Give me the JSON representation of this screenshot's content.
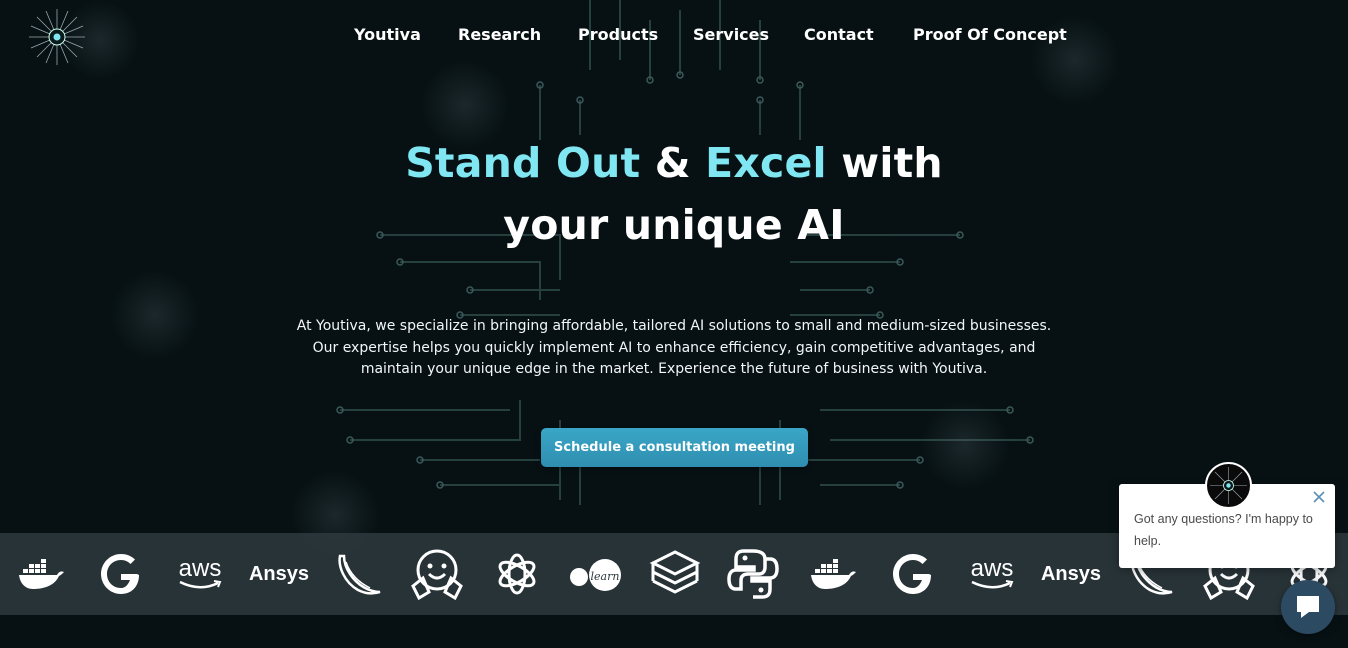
{
  "nav": {
    "items": [
      {
        "label": "Youtiva"
      },
      {
        "label": "Research"
      },
      {
        "label": "Products"
      },
      {
        "label": "Services"
      },
      {
        "label": "Contact"
      },
      {
        "label": "Proof Of Concept"
      }
    ]
  },
  "hero": {
    "title_part1": "Stand Out",
    "title_amp": " & ",
    "title_part2": "Excel",
    "title_part3": " with",
    "title_line2": "your unique AI",
    "description_line1": "At Youtiva, we specialize in bringing affordable, tailored AI solutions to small and medium-sized businesses.",
    "description_line2": "Our expertise helps you quickly implement AI to enhance efficiency, gain competitive advantages, and",
    "description_line3": "maintain your unique edge in the market. Experience the future of business with Youtiva.",
    "cta_label": "Schedule a consultation meeting"
  },
  "partners": {
    "aws_label": "aws",
    "ansys_label": "Ansys",
    "icons": [
      "docker-icon",
      "google-icon",
      "aws-logo",
      "ansys-logo",
      "flask-icon",
      "huggingface-icon",
      "openai-icon",
      "scikit-learn-icon",
      "layers-icon",
      "python-icon"
    ]
  },
  "chat": {
    "message": "Got any questions? I'm happy to help."
  },
  "colors": {
    "accent": "#7fe6f2",
    "cta": "#3aa6c7",
    "background": "#071114"
  }
}
